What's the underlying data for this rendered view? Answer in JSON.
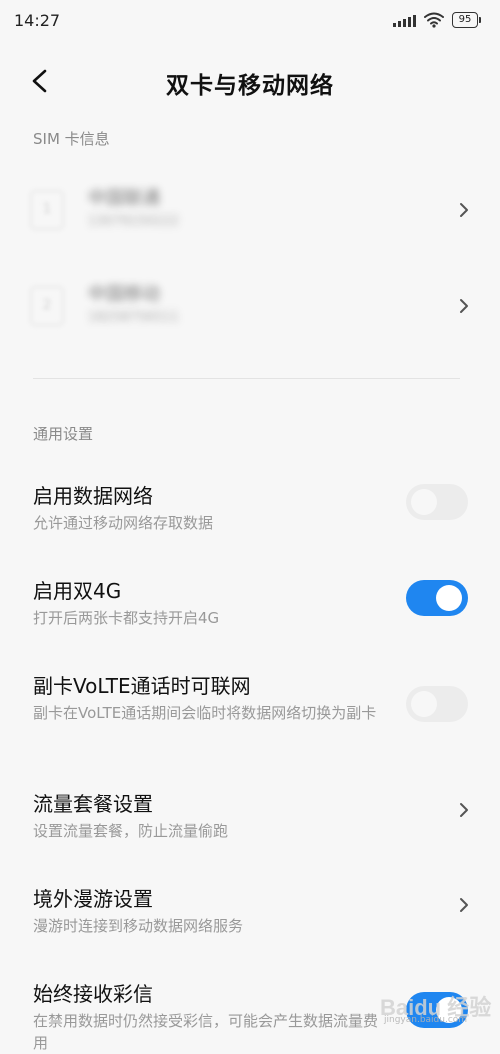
{
  "status_bar": {
    "time": "14:27",
    "battery": "95"
  },
  "header": {
    "title": "双卡与移动网络"
  },
  "sim_section": {
    "label": "SIM 卡信息",
    "cards": [
      {
        "slot": "1",
        "name": "中国联通",
        "number": "13079150222"
      },
      {
        "slot": "2",
        "name": "中国移动",
        "number": "18258756511"
      }
    ]
  },
  "general_section": {
    "label": "通用设置",
    "items": [
      {
        "title": "启用数据网络",
        "desc": "允许通过移动网络存取数据",
        "type": "toggle",
        "on": false
      },
      {
        "title": "启用双4G",
        "desc": "打开后两张卡都支持开启4G",
        "type": "toggle",
        "on": true
      },
      {
        "title": "副卡VoLTE通话时可联网",
        "desc": "副卡在VoLTE通话期间会临时将数据网络切换为副卡",
        "type": "toggle",
        "on": false
      },
      {
        "title": "流量套餐设置",
        "desc": "设置流量套餐，防止流量偷跑",
        "type": "link"
      },
      {
        "title": "境外漫游设置",
        "desc": "漫游时连接到移动数据网络服务",
        "type": "link"
      },
      {
        "title": "始终接收彩信",
        "desc": "在禁用数据时仍然接受彩信，可能会产生数据流量费用",
        "type": "toggle",
        "on": true
      }
    ]
  },
  "watermark": {
    "brand": "Baidu 经验",
    "url": "jingyan.baidu.com"
  },
  "colors": {
    "accent": "#1f86f0",
    "toggle_off": "#ececec",
    "background": "#f7f7f7",
    "secondary_text": "#999999"
  }
}
